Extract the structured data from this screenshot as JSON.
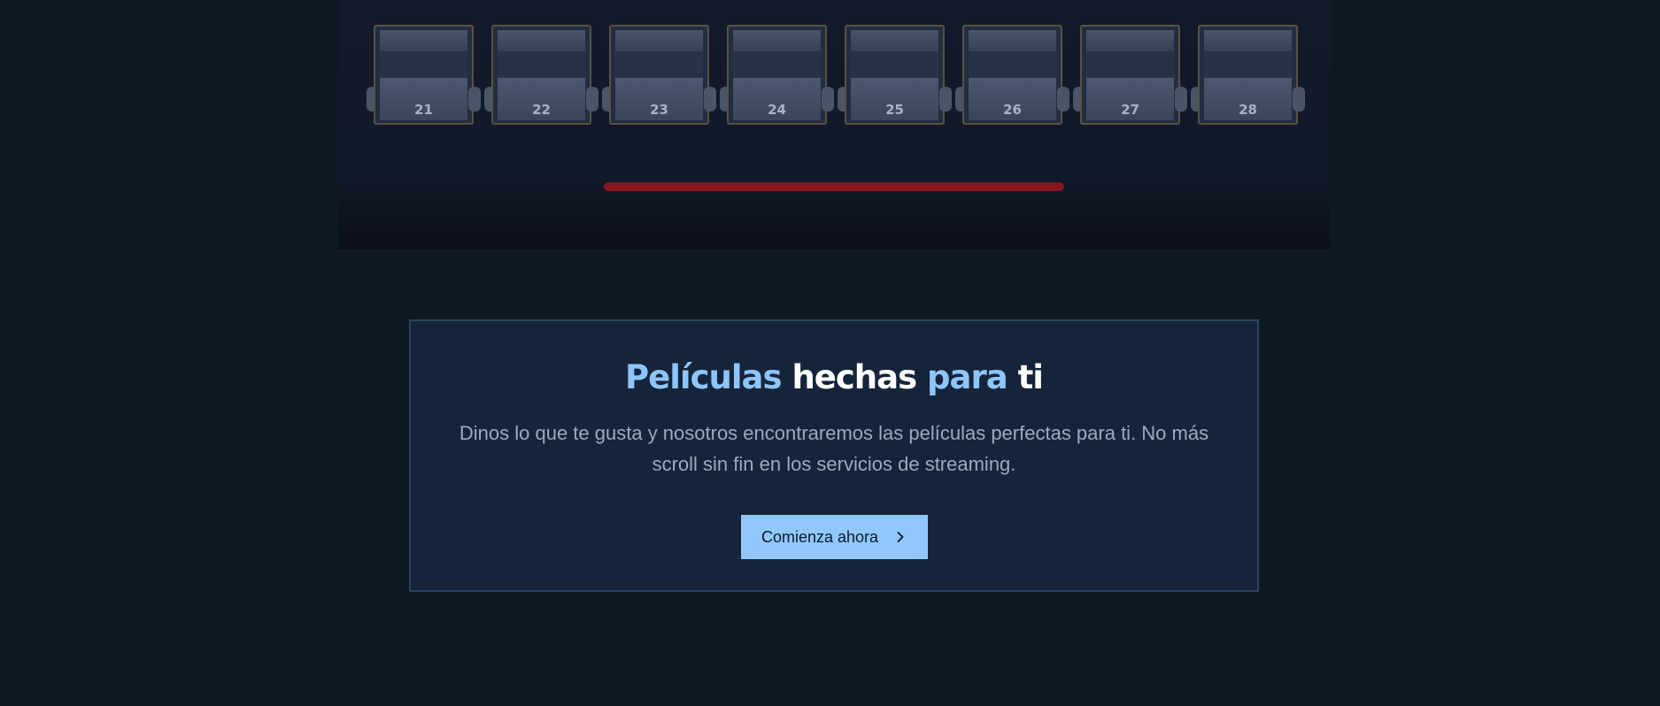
{
  "theater": {
    "seats": [
      {
        "number": "21"
      },
      {
        "number": "22"
      },
      {
        "number": "23"
      },
      {
        "number": "24"
      },
      {
        "number": "25"
      },
      {
        "number": "26"
      },
      {
        "number": "27"
      },
      {
        "number": "28"
      }
    ],
    "screen_color": "#8a1420"
  },
  "cta": {
    "title_word_1": "Películas",
    "title_word_2": "hechas",
    "title_word_3": "para",
    "title_word_4": "ti",
    "description": "Dinos lo que te gusta y nosotros encontraremos las películas perfectas para ti. No más scroll sin fin en los servicios de streaming.",
    "button_label": "Comienza ahora",
    "button_icon": "chevron-right-icon",
    "accent_color": "#8ec5fb",
    "button_color": "#92c7fb"
  }
}
